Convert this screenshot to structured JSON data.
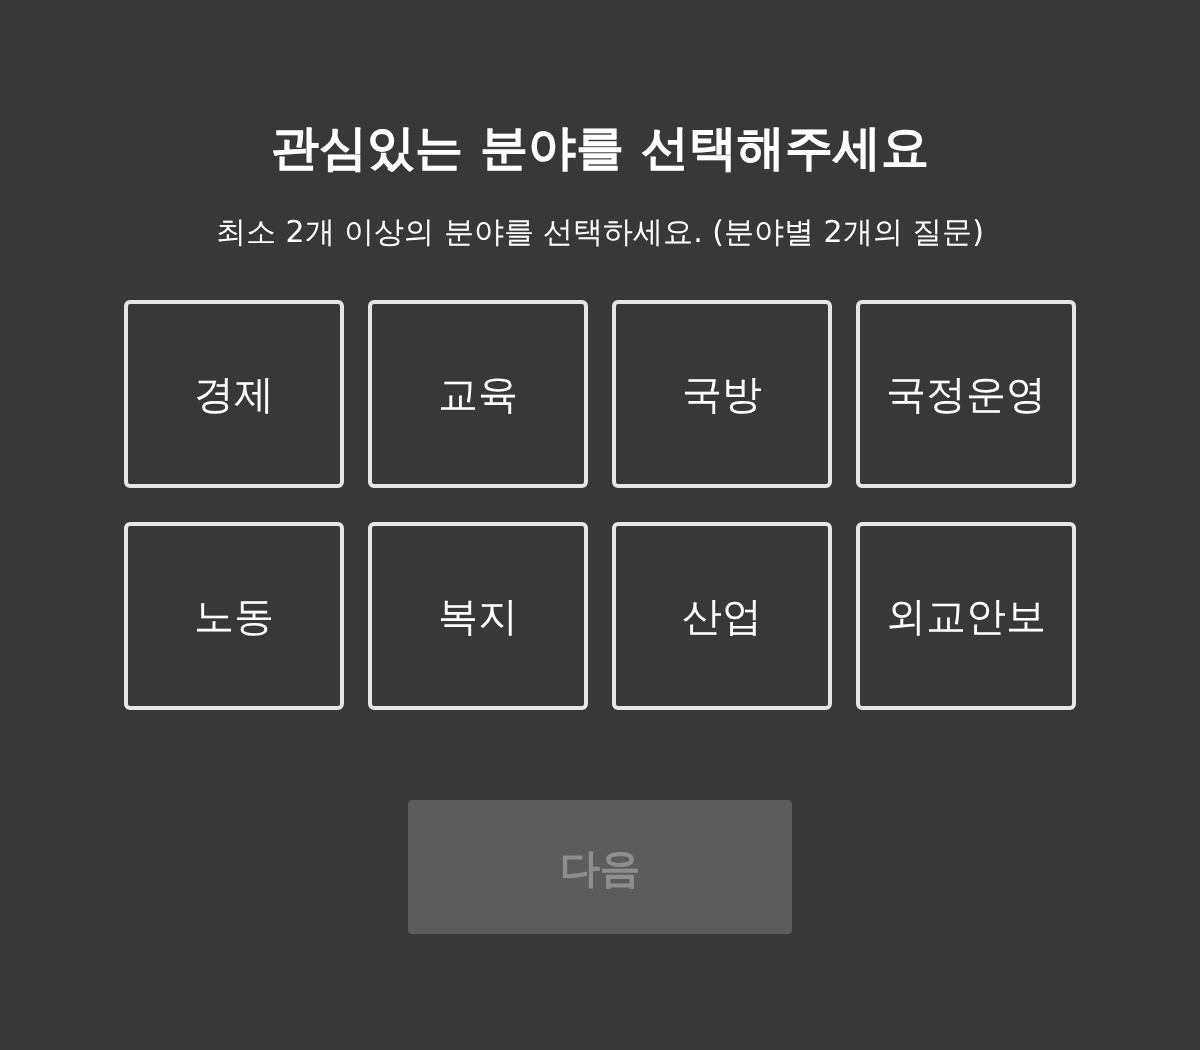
{
  "title": "관심있는 분야를 선택해주세요",
  "subtitle": "최소 2개 이상의 분야를 선택하세요. (분야별 2개의 질문)",
  "fields": [
    {
      "label": "경제",
      "selected": false
    },
    {
      "label": "교육",
      "selected": false
    },
    {
      "label": "국방",
      "selected": false
    },
    {
      "label": "국정운영",
      "selected": false
    },
    {
      "label": "노동",
      "selected": false
    },
    {
      "label": "복지",
      "selected": false
    },
    {
      "label": "산업",
      "selected": false
    },
    {
      "label": "외교안보",
      "selected": false
    }
  ],
  "next_button": {
    "label": "다음",
    "disabled": true
  }
}
